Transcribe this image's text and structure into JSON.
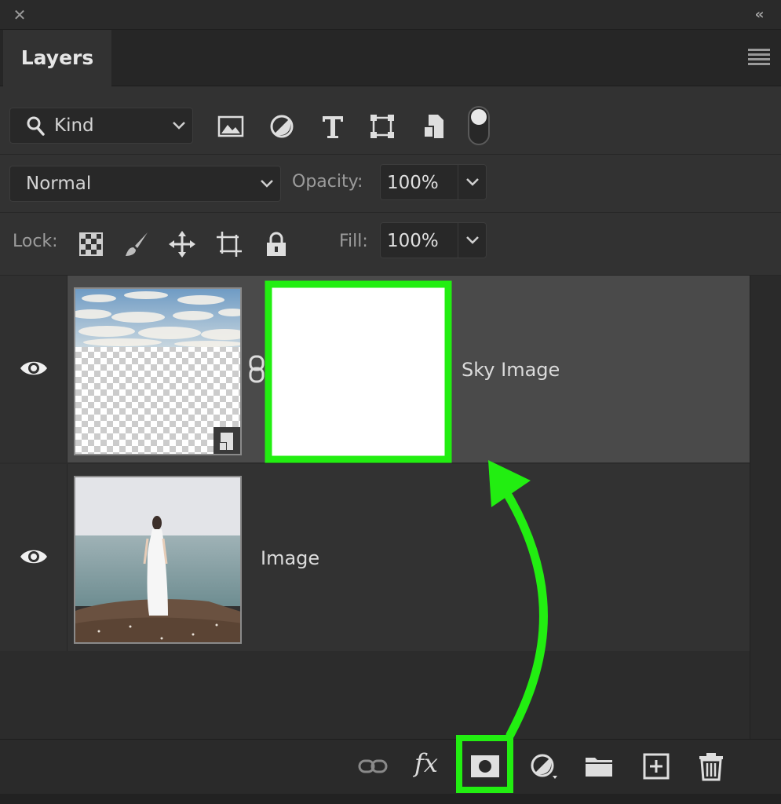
{
  "panel": {
    "tab_label": "Layers"
  },
  "filter": {
    "kind_label": "Kind",
    "icons": [
      "image-filter-icon",
      "adjustment-filter-icon",
      "type-filter-icon",
      "shape-filter-icon",
      "smart-object-filter-icon"
    ]
  },
  "blend": {
    "mode": "Normal",
    "opacity_label": "Opacity:",
    "opacity_value": "100%"
  },
  "lock": {
    "label": "Lock:",
    "fill_label": "Fill:",
    "fill_value": "100%",
    "icons": [
      "lock-transparent-pixels-icon",
      "lock-image-pixels-icon",
      "lock-position-icon",
      "lock-artboard-icon",
      "lock-all-icon"
    ]
  },
  "layers": [
    {
      "name": "Sky Image",
      "selected": true,
      "has_mask": true,
      "smart_object": true
    },
    {
      "name": "Image",
      "selected": false,
      "has_mask": false
    }
  ],
  "bottom_icons": [
    "link-layers-icon",
    "fx-icon",
    "add-mask-icon",
    "adjustment-layer-icon",
    "group-folder-icon",
    "new-layer-icon",
    "trash-icon"
  ],
  "colors": {
    "panel_bg": "#323232",
    "selected_row": "#4a4a4a",
    "annotation_green": "#22ee11"
  }
}
